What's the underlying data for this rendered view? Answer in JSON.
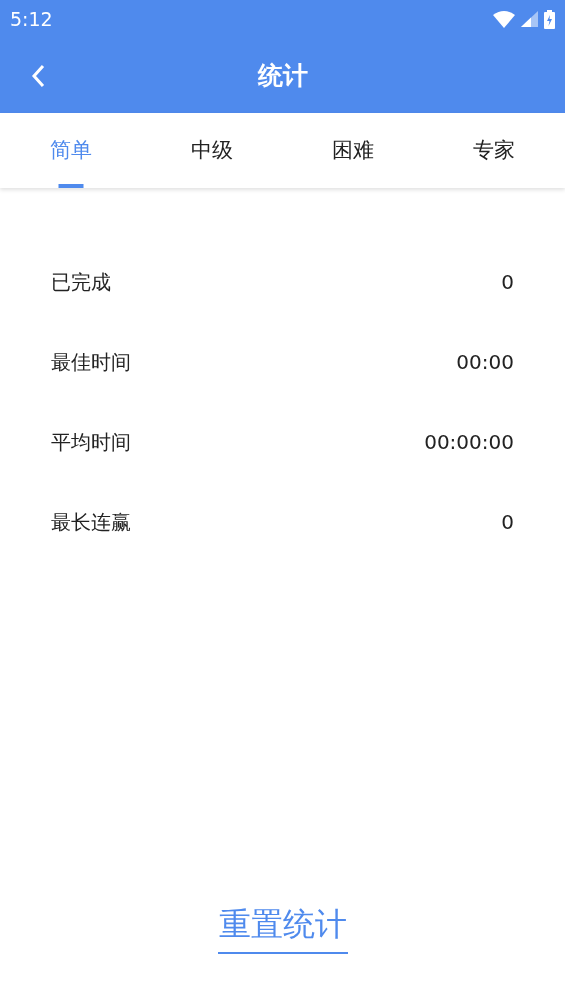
{
  "status_bar": {
    "time": "5:12"
  },
  "app_bar": {
    "title": "统计"
  },
  "tabs": [
    {
      "label": "简单",
      "selected": true
    },
    {
      "label": "中级",
      "selected": false
    },
    {
      "label": "困难",
      "selected": false
    },
    {
      "label": "专家",
      "selected": false
    }
  ],
  "stats": [
    {
      "label": "已完成",
      "value": "0"
    },
    {
      "label": "最佳时间",
      "value": "00:00"
    },
    {
      "label": "平均时间",
      "value": "00:00:00"
    },
    {
      "label": "最长连赢",
      "value": "0"
    }
  ],
  "reset_button": {
    "label": "重置统计"
  }
}
